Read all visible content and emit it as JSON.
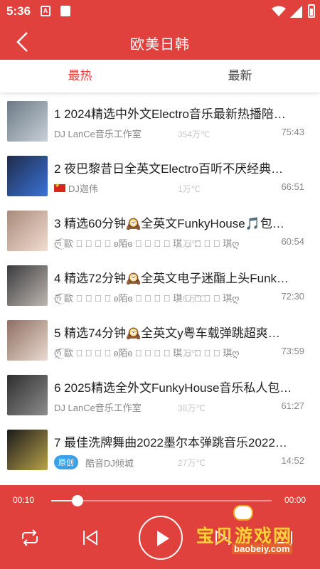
{
  "status": {
    "time": "5:36",
    "a_icon": "A"
  },
  "appbar": {
    "title": "欧美日韩"
  },
  "tabs": [
    {
      "label": "最热"
    },
    {
      "label": "最新"
    }
  ],
  "songs": [
    {
      "title": "1 2024精选中外文Electro音乐最新热播陪…",
      "author": "DJ LanCe音乐工作室",
      "plays": "354万℃",
      "duration": "75:43",
      "thumb": [
        "#6b7a86",
        "#c9d0d6"
      ]
    },
    {
      "title": "2 夜巴黎昔日全英文Electro百听不厌经典…",
      "author": "DJ迦伟",
      "plays": "1万℃",
      "duration": "66:51",
      "thumb": [
        "#1e2b4a",
        "#3b73d8"
      ]
    },
    {
      "title": "3 精选60分钟🕰️全英文FunkyHouse🎵包…",
      "author": "ღ፟፝͜͡ 歐 ᷼ ᷼ ᷼ ᷼ ʚ陌ɞ ᷼ ᷼ ᷼ ᷼ 琪 ᷼ ᷼ ᷼ ᷼ 琪ღ",
      "plays": "1万℃",
      "duration": "60:54",
      "thumb": [
        "#a88b7a",
        "#f1ddd2"
      ]
    },
    {
      "title": "4 精选72分钟🕰️全英文电子迷酯上头Funk…",
      "author": "ღ፟፝͜͡ 歐 ᷼ ᷼ ᷼ ᷼ ʚ陌ɞ ᷼ ᷼ ᷼ ᷼ 琪 ᷼ ᷼ ᷼ ᷼ 琪ღ",
      "plays": "26万℃",
      "duration": "72:30",
      "thumb": [
        "#3a3a3e",
        "#bfb7b0"
      ]
    },
    {
      "title": "5 精选74分钟🕰️全英文y粤车载弹跳超爽…",
      "author": "ღ፟፝͜͡ 歐 ᷼ ᷼ ᷼ ᷼ ʚ陌ɞ ᷼ ᷼ ᷼ ᷼ 琪 ᷼ ᷼ ᷼ ᷼ 琪ღ",
      "plays": "1万℃",
      "duration": "73:59",
      "thumb": [
        "#8e6f62",
        "#eadad0"
      ]
    },
    {
      "title": "6 2025精选全外文FunkyHouse音乐私人包…",
      "author": "DJ LanCe音乐工作室",
      "plays": "38万℃",
      "duration": "61:27",
      "thumb": [
        "#2e2e2e",
        "#8d8d8d"
      ]
    },
    {
      "title": "7 最佳洗牌舞曲2022墨尔本弹跳音乐2022…",
      "author": "酷音DJ倾城",
      "badge": "原创",
      "plays": "27万℃",
      "duration": "14:52",
      "thumb": [
        "#1b1b1b",
        "#b8a24a"
      ]
    }
  ],
  "player": {
    "current": "00:10",
    "total": "00:00",
    "progress": 0.12
  },
  "watermark": {
    "text": "宝贝游戏网",
    "sub": "baobeiy.com"
  },
  "colors": {
    "accent": "#e0413c",
    "badge": "#3aa0e8"
  }
}
